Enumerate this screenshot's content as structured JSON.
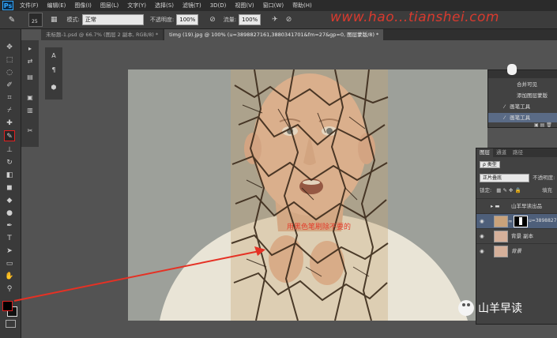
{
  "menu": {
    "logo": "Ps",
    "items": [
      "文件(F)",
      "编辑(E)",
      "图像(I)",
      "图层(L)",
      "文字(Y)",
      "选择(S)",
      "滤镜(T)",
      "3D(D)",
      "视图(V)",
      "窗口(W)",
      "帮助(H)"
    ]
  },
  "options": {
    "brush_size": "25",
    "mode_label": "模式:",
    "mode_value": "正常",
    "opacity_label": "不透明度:",
    "opacity_value": "100%",
    "flow_label": "流量:",
    "flow_value": "100%"
  },
  "watermark": "www.hao...tianshei.com",
  "tabs": [
    "未标题-1.psd @ 66.7% (图层 2 副本, RGB/8) *",
    "timg (19).jpg @ 100% (u=3898827161,3880341701&fm=27&gp=0, 图层蒙版/8) *"
  ],
  "canvas_note": "用黑色笔刷除不要的",
  "history": {
    "items": [
      "合并可见",
      "添加图层蒙版",
      "画笔工具",
      "画笔工具"
    ]
  },
  "layers": {
    "tabs": [
      "图层",
      "通道",
      "路径"
    ],
    "filter_value": "ρ 类型",
    "blend_value": "正片叠底",
    "opacity_label": "不透明度:",
    "lock_label": "锁定:",
    "fill_label": "填充",
    "rows": [
      {
        "name": "山羊早读出品",
        "kind": "group"
      },
      {
        "name": "u=3898827",
        "kind": "masked"
      },
      {
        "name": "背景 副本",
        "kind": "normal"
      },
      {
        "name": "背景",
        "kind": "normal"
      }
    ]
  },
  "brand": "山羊早读",
  "colors": {
    "annotation_red": "#e43a2a",
    "selection_blue": "#4e5f7a",
    "ui_dark": "#2b2b2b"
  }
}
